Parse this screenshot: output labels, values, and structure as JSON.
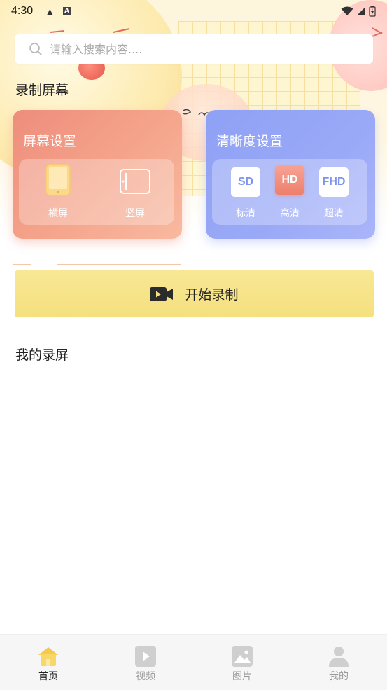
{
  "status_bar": {
    "time": "4:30",
    "icons": [
      "notification-dot-icon",
      "a-badge-icon",
      "wifi-icon",
      "signal-icon",
      "battery-icon"
    ]
  },
  "search": {
    "placeholder": "请输入搜索内容...."
  },
  "record_section": {
    "title": "录制屏幕"
  },
  "screen_settings": {
    "title": "屏幕设置",
    "options": [
      {
        "label": "横屏",
        "icon": "landscape-phone-icon",
        "selected": true
      },
      {
        "label": "竖屏",
        "icon": "portrait-outline-icon",
        "selected": false
      }
    ]
  },
  "clarity_settings": {
    "title": "清晰度设置",
    "options": [
      {
        "badge": "SD",
        "label": "标清",
        "selected": false
      },
      {
        "badge": "HD",
        "label": "高清",
        "selected": true
      },
      {
        "badge": "FHD",
        "label": "超清",
        "selected": false
      }
    ]
  },
  "start_button": {
    "label": "开始录制",
    "icon": "video-camera-icon"
  },
  "my_recordings": {
    "title": "我的录屏"
  },
  "bottom_nav": {
    "items": [
      {
        "label": "首页",
        "icon": "home-icon",
        "active": true
      },
      {
        "label": "视频",
        "icon": "play-icon",
        "active": false
      },
      {
        "label": "图片",
        "icon": "image-icon",
        "active": false
      },
      {
        "label": "我的",
        "icon": "user-icon",
        "active": false
      }
    ]
  },
  "colors": {
    "screen_card": "#F09A86",
    "clarity_card": "#94A4F6",
    "start_button": "#F6E384",
    "active_badge": "#EE7F6C",
    "nav_home": "#F6C94A"
  }
}
